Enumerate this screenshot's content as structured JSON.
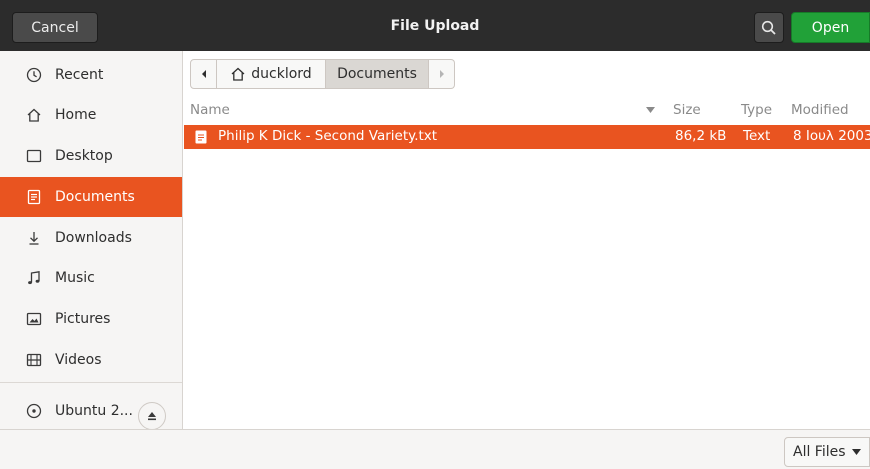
{
  "header": {
    "cancel_label": "Cancel",
    "title": "File Upload",
    "open_label": "Open"
  },
  "sidebar": {
    "items": [
      {
        "label": "Recent",
        "icon": "clock-icon"
      },
      {
        "label": "Home",
        "icon": "home-icon"
      },
      {
        "label": "Desktop",
        "icon": "desktop-icon"
      },
      {
        "label": "Documents",
        "icon": "document-icon"
      },
      {
        "label": "Downloads",
        "icon": "download-icon"
      },
      {
        "label": "Music",
        "icon": "music-note-icon"
      },
      {
        "label": "Pictures",
        "icon": "picture-icon"
      },
      {
        "label": "Videos",
        "icon": "film-icon"
      }
    ],
    "drive": {
      "label": "Ubuntu 2...",
      "icon": "disc-icon",
      "eject_icon": "eject-icon"
    }
  },
  "pathbar": {
    "home_label": "ducklord",
    "current_label": "Documents"
  },
  "columns": {
    "name": "Name",
    "size": "Size",
    "type": "Type",
    "modified": "Modified"
  },
  "files": [
    {
      "name": "Philip K Dick - Second Variety.txt",
      "size": "86,2 kB",
      "type": "Text",
      "modified": "8 Ιουλ 2003"
    }
  ],
  "filter": {
    "label": "All Files"
  },
  "colors": {
    "accent": "#e95420",
    "open_button": "#21a138",
    "header_bg": "#2c2c2c"
  }
}
